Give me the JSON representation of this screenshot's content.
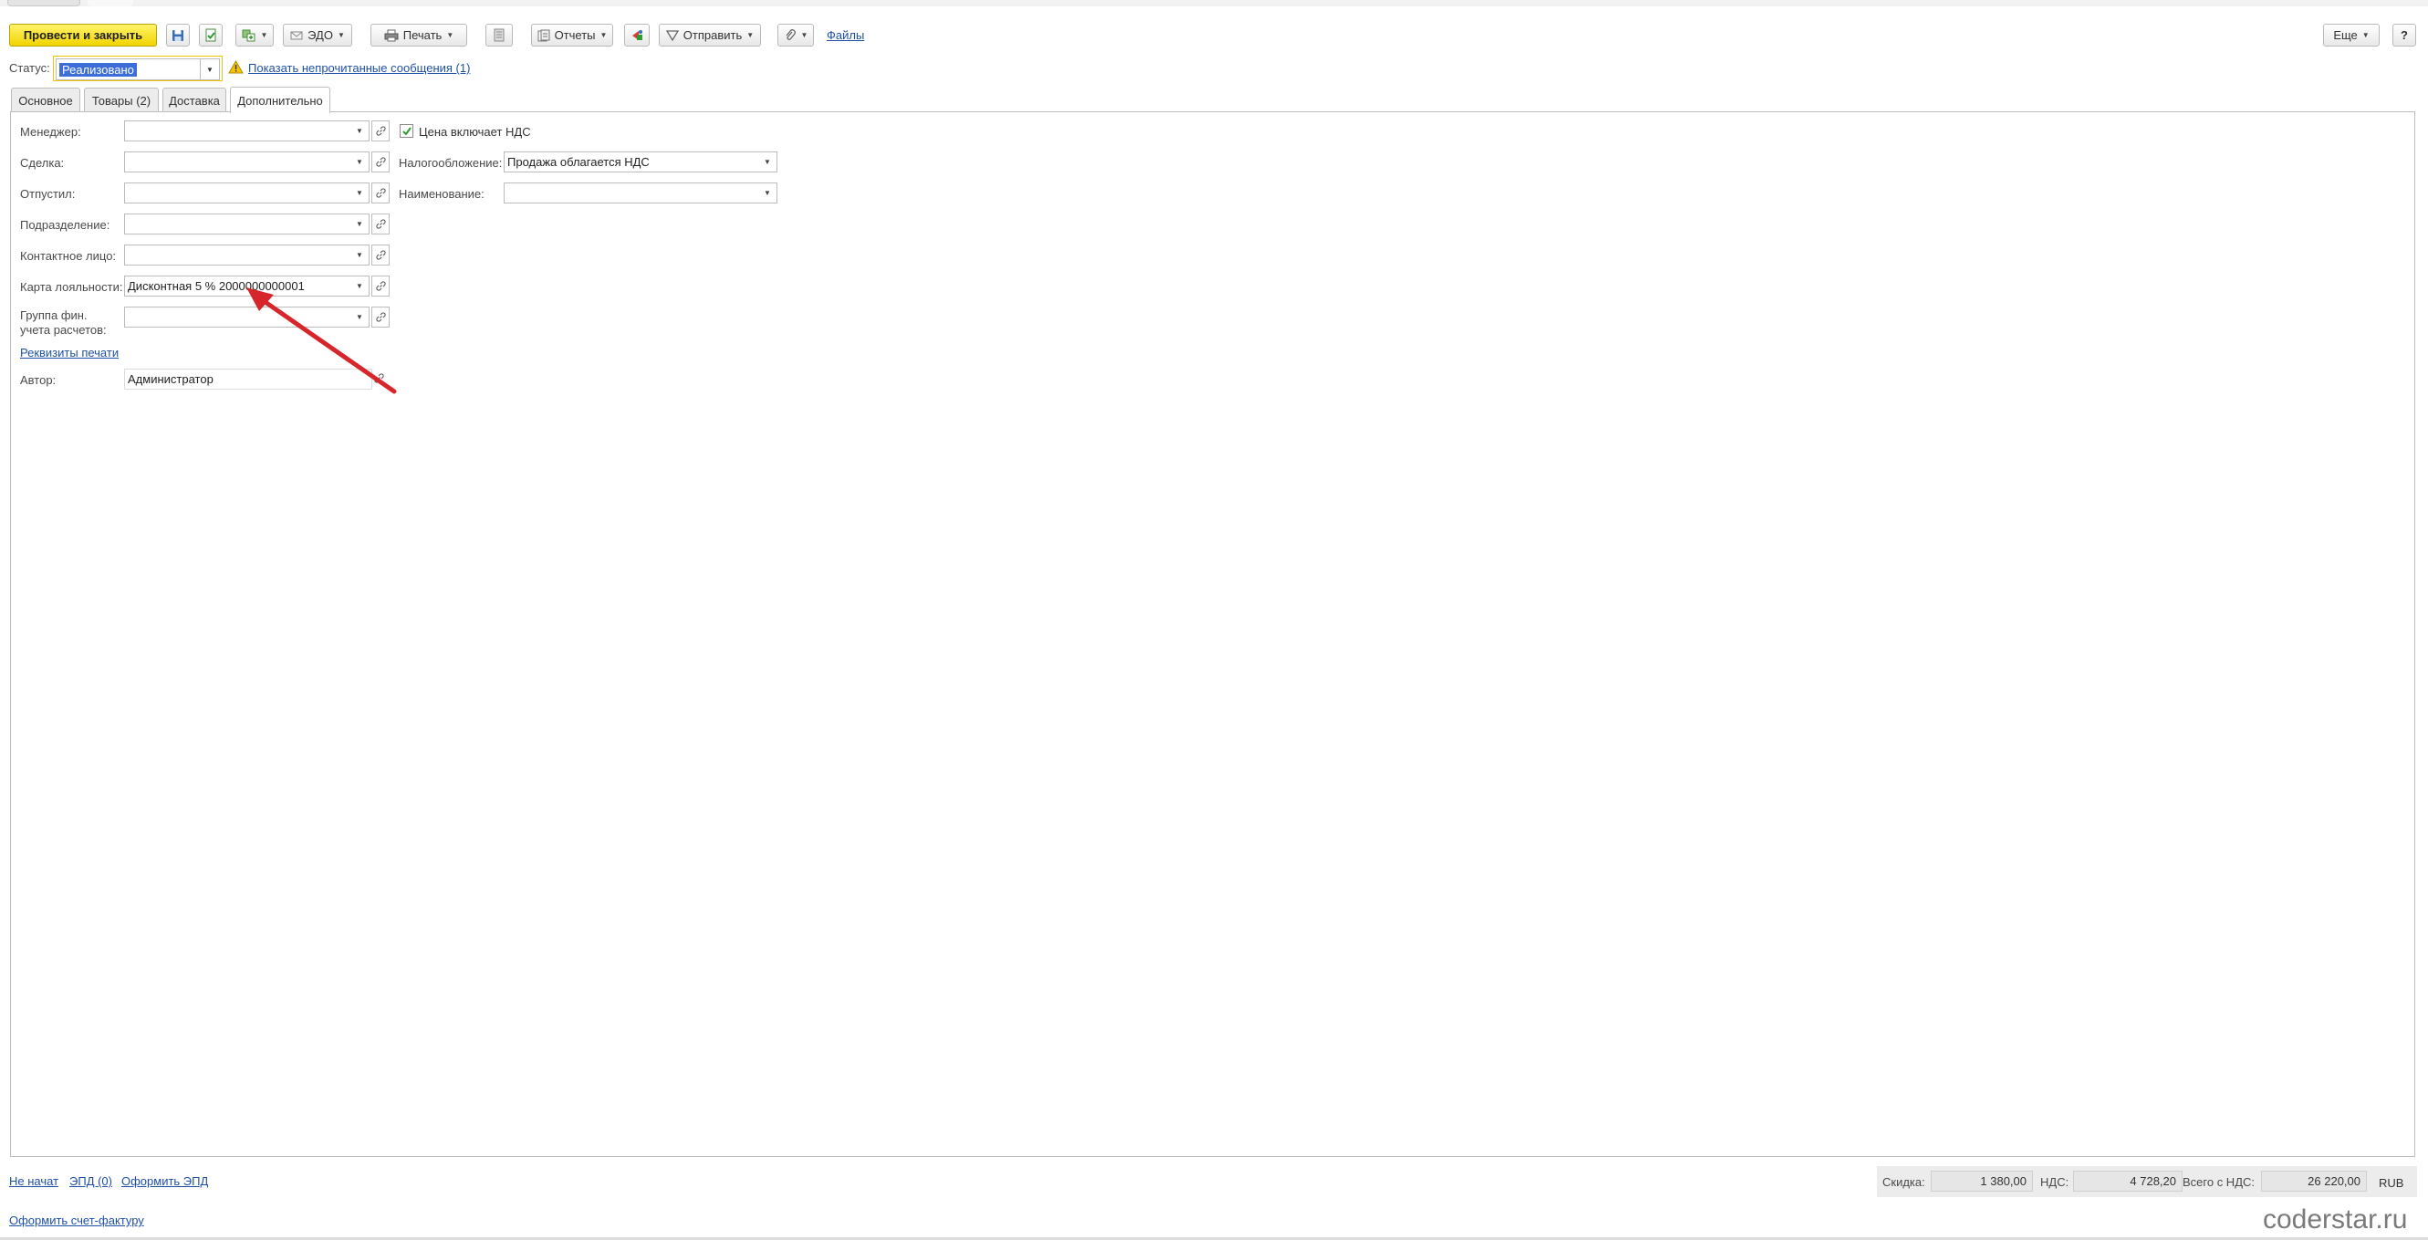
{
  "toolbar": {
    "post_and_close": "Провести и закрыть",
    "edo": "ЭДО",
    "print": "Печать",
    "reports": "Отчеты",
    "send": "Отправить",
    "files": "Файлы",
    "more": "Еще",
    "help": "?"
  },
  "status": {
    "label": "Статус:",
    "value": "Реализовано",
    "unread_link": "Показать непрочитанные сообщения (1)"
  },
  "tabs": [
    {
      "label": "Основное"
    },
    {
      "label": "Товары (2)"
    },
    {
      "label": "Доставка"
    },
    {
      "label": "Дополнительно"
    }
  ],
  "form": {
    "manager": {
      "label": "Менеджер:",
      "value": ""
    },
    "deal": {
      "label": "Сделка:",
      "value": ""
    },
    "released_by": {
      "label": "Отпустил:",
      "value": ""
    },
    "department": {
      "label": "Подразделение:",
      "value": ""
    },
    "contact": {
      "label": "Контактное лицо:",
      "value": ""
    },
    "loyalty_card": {
      "label": "Карта лояльности:",
      "value": "Дисконтная 5 % 2000000000001"
    },
    "fin_group": {
      "label_line1": "Группа фин.",
      "label_line2": "учета расчетов:",
      "value": ""
    },
    "print_details_link": "Реквизиты печати",
    "author": {
      "label": "Автор:",
      "value": "Администратор"
    },
    "price_includes_vat": {
      "label": "Цена включает НДС",
      "checked": true
    },
    "taxation": {
      "label": "Налогообложение:",
      "value": "Продажа облагается НДС"
    },
    "name": {
      "label": "Наименование:",
      "value": ""
    }
  },
  "footer": {
    "links": [
      "Не начат",
      "ЭПД (0)",
      "Оформить ЭПД"
    ],
    "invoice_link": "Оформить счет-фактуру",
    "discount_label": "Скидка:",
    "discount_value": "1 380,00",
    "vat_label": "НДС:",
    "vat_value": "4 728,20",
    "total_label": "Всего с НДС:",
    "total_value": "26 220,00",
    "currency": "RUB"
  },
  "watermark": "coderstar.ru",
  "colors": {
    "primary_button": "#f2d400",
    "link": "#1f50a8",
    "selection": "#3b6ed9",
    "annotation_arrow": "#d7262b"
  }
}
